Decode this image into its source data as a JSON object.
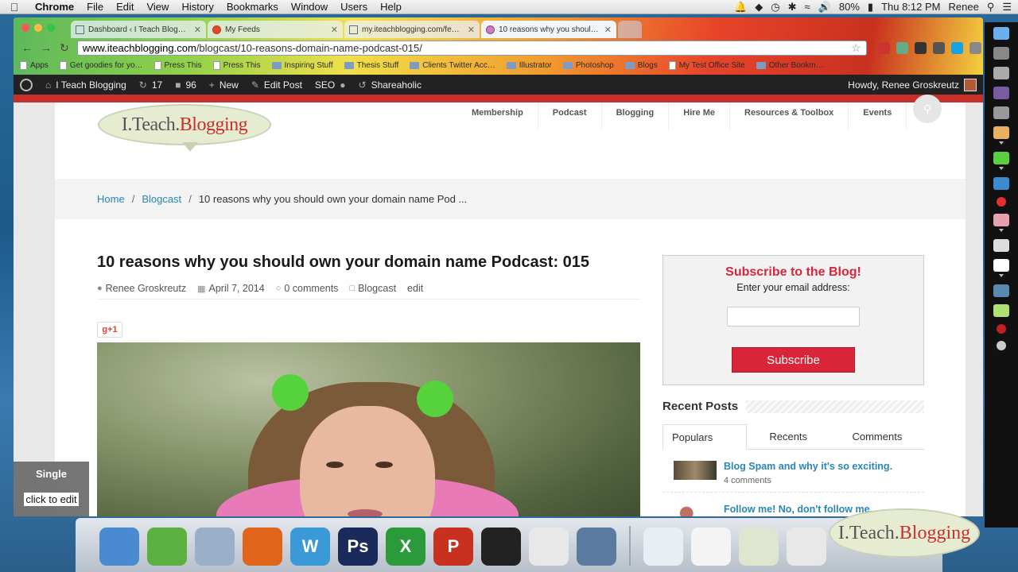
{
  "menubar": {
    "app": "Chrome",
    "items": [
      "File",
      "Edit",
      "View",
      "History",
      "Bookmarks",
      "Window",
      "Users",
      "Help"
    ],
    "battery": "80%",
    "clock": "Thu 8:12 PM",
    "user": "Renee"
  },
  "browser": {
    "tabs": [
      {
        "title": "Dashboard ‹ I Teach Blogg…",
        "icon": "wp-dashboard-icon"
      },
      {
        "title": "My Feeds",
        "icon": "feed-icon"
      },
      {
        "title": "my.iteachblogging.com/fe…",
        "icon": "page-icon"
      },
      {
        "title": "10 reasons why you shoul…",
        "icon": "podcast-icon"
      }
    ],
    "url_host": "www.iteachblogging.com",
    "url_path": "/blogcast/10-reasons-domain-name-podcast-015/",
    "bookmarks": [
      "Apps",
      "Get goodies for yo…",
      "Press This",
      "Press This",
      "Inspiring Stuff",
      "Thesis Stuff",
      "Clients Twitter Acc…",
      "Illustrator",
      "Photoshop",
      "Blogs",
      "My Test Office Site",
      "Other Bookm…"
    ]
  },
  "adminbar": {
    "site_name": "I Teach Blogging",
    "updates": "17",
    "comments": "96",
    "new_label": "New",
    "edit_post": "Edit Post",
    "seo": "SEO",
    "shareaholic": "Shareaholic",
    "howdy": "Howdy, Renee Groskreutz"
  },
  "site": {
    "logo_part1": "I.Teach.",
    "logo_part2": "Blogging",
    "nav": [
      "Membership",
      "Podcast",
      "Blogging",
      "Hire Me",
      "Resources & Toolbox",
      "Events"
    ]
  },
  "breadcrumbs": {
    "home": "Home",
    "section": "Blogcast",
    "current": "10 reasons why you should own your domain name Pod ..."
  },
  "post": {
    "title": "10 reasons why you should own your domain name Podcast: 015",
    "author": "Renee Groskreutz",
    "date": "April 7, 2014",
    "comments": "0 comments",
    "category": "Blogcast",
    "edit": "edit",
    "gplus": "g+1"
  },
  "sidebar": {
    "subscribe_title": "Subscribe to the Blog!",
    "subscribe_prompt": "Enter your email address:",
    "subscribe_button": "Subscribe",
    "recent_title": "Recent Posts",
    "tabs": [
      "Populars",
      "Recents",
      "Comments"
    ],
    "posts": [
      {
        "title": "Blog Spam and why it's so exciting.",
        "comments": "4 comments"
      },
      {
        "title": "Follow me! No, don't follow me. Connect with me instead …",
        "comments": ""
      }
    ]
  },
  "overlay": {
    "single": "Single",
    "click_to_edit": "click to edit"
  },
  "colors": {
    "brand_red": "#c9302c",
    "subscribe_red": "#d9253a",
    "link_blue": "#2a86b4",
    "admin_bar": "#222222"
  }
}
